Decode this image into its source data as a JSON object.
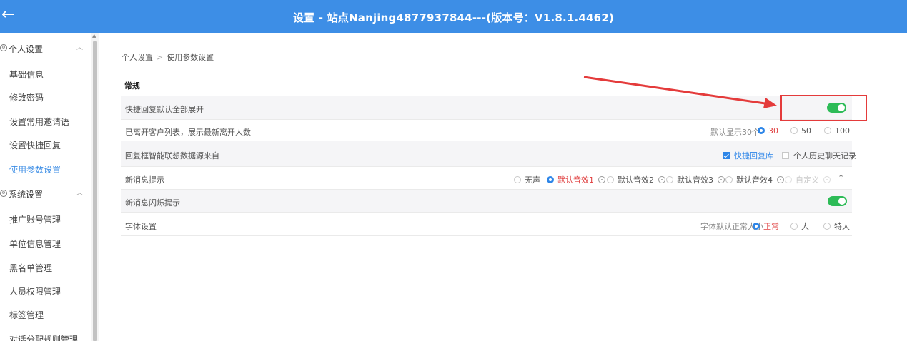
{
  "window": {
    "title": "设置 - 站点Nanjing4877937844---(版本号：V1.8.1.4462)",
    "back_icon": "←"
  },
  "sidebar": {
    "groups": [
      {
        "label": "个人设置",
        "icon": "gear-icon",
        "items": [
          "基础信息",
          "修改密码",
          "设置常用邀请语",
          "设置快捷回复",
          "使用参数设置"
        ]
      },
      {
        "label": "系统设置",
        "icon": "gear-icon",
        "items": [
          "推广账号管理",
          "单位信息管理",
          "黑名单管理",
          "人员权限管理",
          "标签管理",
          "对话分配规则管理"
        ]
      }
    ],
    "active_item": "使用参数设置"
  },
  "breadcrumb": [
    "个人设置",
    "使用参数设置"
  ],
  "section": {
    "title": "常规"
  },
  "settings": {
    "quick_reply_expand": {
      "label": "快捷回复默认全部展开",
      "enabled": true
    },
    "departed_customers": {
      "label": "已离开客户列表，展示最新离开人数",
      "prefix": "默认显示30个",
      "options": [
        "30",
        "50",
        "100"
      ],
      "selected": "30"
    },
    "reply_suggest_source": {
      "label": "回复框智能联想数据源来自",
      "options": [
        {
          "label": "快捷回复库",
          "checked": true
        },
        {
          "label": "个人历史聊天记录",
          "checked": false
        }
      ]
    },
    "new_message_alert": {
      "label": "新消息提示",
      "options": [
        "无声",
        "默认音效1",
        "默认音效2",
        "默认音效3",
        "默认音效4",
        "自定义"
      ],
      "selected": "默认音效1",
      "upload_icon": "⇡"
    },
    "new_message_flash": {
      "label": "新消息闪烁提示",
      "enabled": true
    },
    "font_size": {
      "label": "字体设置",
      "prefix": "字体默认正常大小",
      "options": [
        "正常",
        "大",
        "特大"
      ],
      "selected": "正常"
    }
  },
  "colors": {
    "titlebar": "#3d8ee6",
    "toggle_on": "#2dbb57",
    "selected_text": "#e04040",
    "annotation": "#e43b3b"
  }
}
